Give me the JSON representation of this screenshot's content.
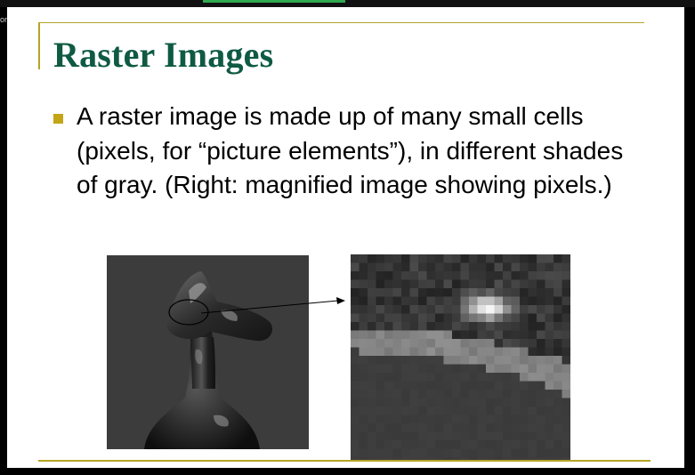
{
  "window": {
    "left_edge_fragment": "orc"
  },
  "slide": {
    "title": "Raster Images",
    "bullet": "A raster image is made up of many small cells (pixels, for “picture elements”), in different shades of gray. (Right: magnified image showing pixels.)",
    "bullet_icon": "square-bullet-icon"
  },
  "colors": {
    "title": "#0e5a43",
    "rule": "#b5a428",
    "bullet": "#c4a517",
    "image_background": "#3c3c3c",
    "taskbar_accent": "#2fa84f"
  },
  "images": {
    "left": "3d-rendered-object-grayscale",
    "right": "magnified-pixel-grid"
  }
}
